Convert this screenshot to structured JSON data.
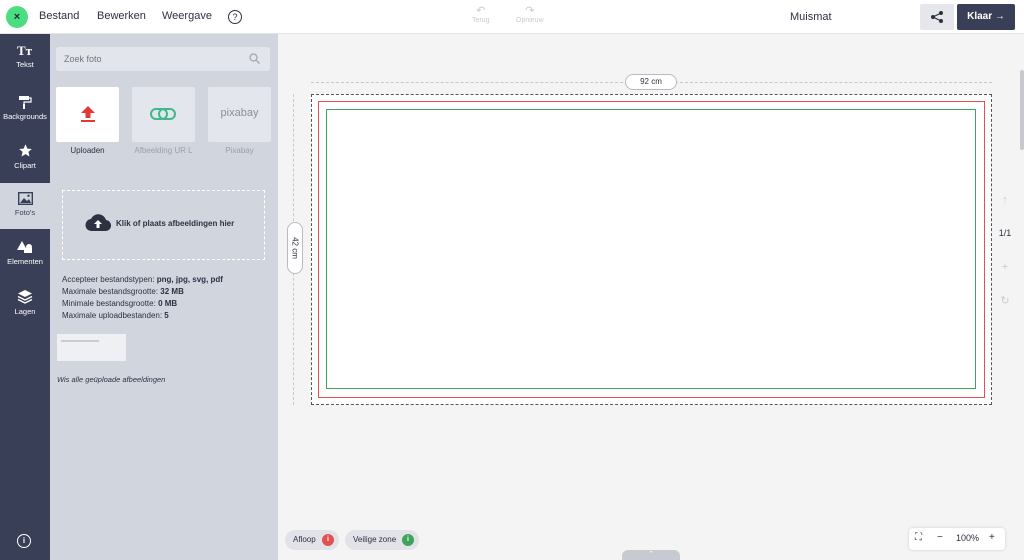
{
  "topbar": {
    "close_symbol": "×",
    "menu": [
      "Bestand",
      "Bewerken",
      "Weergave"
    ],
    "help_symbol": "?",
    "undo_label": "Terug",
    "redo_label": "Opnieuw",
    "title": "Muismat",
    "done_label": "Klaar →"
  },
  "rail": {
    "items": [
      {
        "label": "Tekst",
        "icon": "text-icon"
      },
      {
        "label": "Backgrounds",
        "icon": "paint-roller-icon"
      },
      {
        "label": "Clipart",
        "icon": "star-icon"
      },
      {
        "label": "Foto's",
        "icon": "image-icon"
      },
      {
        "label": "Elementen",
        "icon": "shapes-icon"
      },
      {
        "label": "Lagen",
        "icon": "layers-icon"
      }
    ],
    "info_symbol": "i"
  },
  "panel": {
    "search_placeholder": "Zoek foto",
    "sources": [
      {
        "label": "Uploaden"
      },
      {
        "label": "Afbeelding UR L"
      },
      {
        "label": "Pixabay",
        "logo": "pixabay"
      }
    ],
    "dropzone_text": "Klik of plaats afbeeldingen hier",
    "info": [
      {
        "label": "Accepteer bestandstypen: ",
        "value": "png, jpg, svg, pdf"
      },
      {
        "label": "Maximale bestandsgrootte: ",
        "value": "32 MB"
      },
      {
        "label": "Minimale bestandsgrootte: ",
        "value": "0 MB"
      },
      {
        "label": "Maximale uploadbestanden: ",
        "value": "5"
      }
    ],
    "show_all": "Wis alle geüploade afbeeldingen"
  },
  "canvas": {
    "width_label": "92 cm",
    "height_label": "42 cm",
    "page_count": "1/1",
    "colors": {
      "bleed": "#e05252",
      "safe": "#3fa35b"
    }
  },
  "bottom": {
    "bleed_label": "Afloop",
    "safe_label": "Veilige zone",
    "zoom": "100%",
    "info_symbol": "i"
  },
  "colors": {
    "rail": "#3a3f58",
    "panel": "#d1d5de",
    "accent_green": "#4ade80",
    "done_button": "#3a3f58"
  }
}
